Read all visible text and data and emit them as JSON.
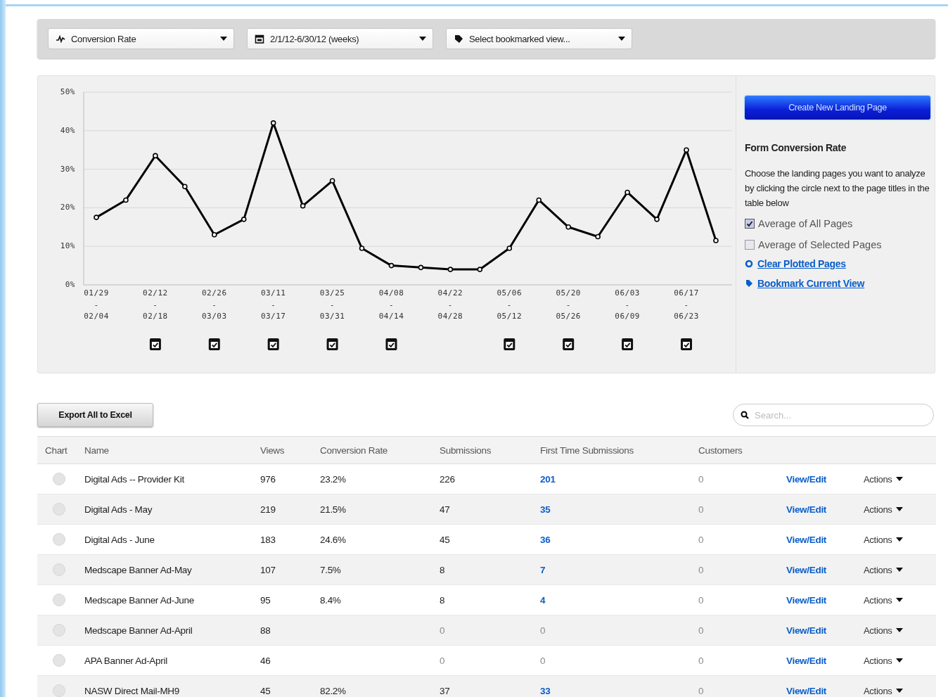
{
  "toolbar": {
    "dropdowns": [
      {
        "kind": "metric",
        "label": "Conversion Rate"
      },
      {
        "kind": "date",
        "label": "2/1/12-6/30/12 (weeks)"
      },
      {
        "kind": "bookmark",
        "label": "Select bookmarked view..."
      }
    ]
  },
  "chart": {
    "chart_data": {
      "type": "line",
      "categories": [
        "01/29\n-\n02/04",
        null,
        "02/12\n-\n02/18",
        null,
        "02/26\n-\n03/03",
        null,
        "03/11\n-\n03/17",
        null,
        "03/25\n-\n03/31",
        null,
        "04/08\n-\n04/14",
        null,
        "04/22\n-\n04/28",
        null,
        "05/06\n-\n05/12",
        null,
        "05/20\n-\n05/26",
        null,
        "06/03\n-\n06/09",
        null,
        "06/17\n-\n06/23",
        null
      ],
      "grid": true,
      "series": [
        {
          "color": "#000000",
          "marker": "circle",
          "values": [
            17.5,
            22,
            33.5,
            25.5,
            13,
            17,
            42,
            20.5,
            27,
            9.5,
            5,
            4.5,
            4,
            4,
            9.5,
            22,
            15,
            12.5,
            24,
            17,
            35,
            11.5
          ]
        }
      ],
      "ylim": [
        0,
        50
      ],
      "yticks": [
        {
          "value": 0,
          "label": "0%"
        },
        {
          "value": 10,
          "label": "10%"
        },
        {
          "value": 20,
          "label": "20%"
        },
        {
          "value": 30,
          "label": "30%"
        },
        {
          "value": 40,
          "label": "40%"
        },
        {
          "value": 50,
          "label": "50%"
        }
      ]
    },
    "week_notes": [
      {
        "shown": false
      },
      {
        "shown": true
      },
      {
        "shown": true
      },
      {
        "shown": true
      },
      {
        "shown": true
      },
      {
        "shown": true
      },
      {
        "shown": false
      },
      {
        "shown": true
      },
      {
        "shown": true
      },
      {
        "shown": true
      },
      {
        "shown": true
      }
    ]
  },
  "sidebar": {
    "button": "Create New Landing Page",
    "title": "Form Conversion Rate",
    "description": "Choose the landing pages you want to analyze by clicking the circle next to the page titles in the table below",
    "options": [
      {
        "label": "Average of All Pages",
        "checked": true
      },
      {
        "label": "Average of Selected Pages",
        "checked": false
      }
    ],
    "links": [
      {
        "kind": "clear",
        "label": "Clear Plotted Pages"
      },
      {
        "kind": "bookmark",
        "label": "Bookmark Current View"
      }
    ]
  },
  "export_button": "Export All to Excel",
  "search": {
    "placeholder": "Search..."
  },
  "table": {
    "columns": [
      "Chart",
      "Name",
      "Views",
      "Conversion Rate",
      "Submissions",
      "First Time Submissions",
      "Customers"
    ],
    "rows": [
      {
        "selected": false,
        "name": "Digital Ads -- Provider Kit",
        "views": "976",
        "conversion_rate": "23.2%",
        "submissions": {
          "value": "226",
          "muted": false
        },
        "first_time": {
          "value": "201",
          "muted": false
        },
        "customers": {
          "value": "0",
          "muted": true
        },
        "edit": "View/Edit",
        "actions": "Actions"
      },
      {
        "selected": false,
        "name": "Digital Ads - May",
        "views": "219",
        "conversion_rate": "21.5%",
        "submissions": {
          "value": "47",
          "muted": false
        },
        "first_time": {
          "value": "35",
          "muted": false
        },
        "customers": {
          "value": "0",
          "muted": true
        },
        "edit": "View/Edit",
        "actions": "Actions"
      },
      {
        "selected": false,
        "name": "Digital Ads - June",
        "views": "183",
        "conversion_rate": "24.6%",
        "submissions": {
          "value": "45",
          "muted": false
        },
        "first_time": {
          "value": "36",
          "muted": false
        },
        "customers": {
          "value": "0",
          "muted": true
        },
        "edit": "View/Edit",
        "actions": "Actions"
      },
      {
        "selected": false,
        "name": "Medscape Banner Ad-May",
        "views": "107",
        "conversion_rate": "7.5%",
        "submissions": {
          "value": "8",
          "muted": false
        },
        "first_time": {
          "value": "7",
          "muted": false
        },
        "customers": {
          "value": "0",
          "muted": true
        },
        "edit": "View/Edit",
        "actions": "Actions"
      },
      {
        "selected": false,
        "name": "Medscape Banner Ad-June",
        "views": "95",
        "conversion_rate": "8.4%",
        "submissions": {
          "value": "8",
          "muted": false
        },
        "first_time": {
          "value": "4",
          "muted": false
        },
        "customers": {
          "value": "0",
          "muted": true
        },
        "edit": "View/Edit",
        "actions": "Actions"
      },
      {
        "selected": false,
        "name": "Medscape Banner Ad-April",
        "views": "88",
        "submissions": {
          "value": "0",
          "muted": true
        },
        "first_time": {
          "value": "0",
          "muted": true
        },
        "customers": {
          "value": "0",
          "muted": true
        },
        "edit": "View/Edit",
        "actions": "Actions"
      },
      {
        "selected": false,
        "name": "APA Banner Ad-April",
        "views": "46",
        "submissions": {
          "value": "0",
          "muted": true
        },
        "first_time": {
          "value": "0",
          "muted": true
        },
        "customers": {
          "value": "0",
          "muted": true
        },
        "edit": "View/Edit",
        "actions": "Actions"
      },
      {
        "selected": false,
        "name": "NASW Direct Mail-MH9",
        "views": "45",
        "conversion_rate": "82.2%",
        "submissions": {
          "value": "37",
          "muted": false
        },
        "first_time": {
          "value": "33",
          "muted": false
        },
        "customers": {
          "value": "0",
          "muted": true
        },
        "edit": "View/Edit",
        "actions": "Actions"
      }
    ]
  }
}
